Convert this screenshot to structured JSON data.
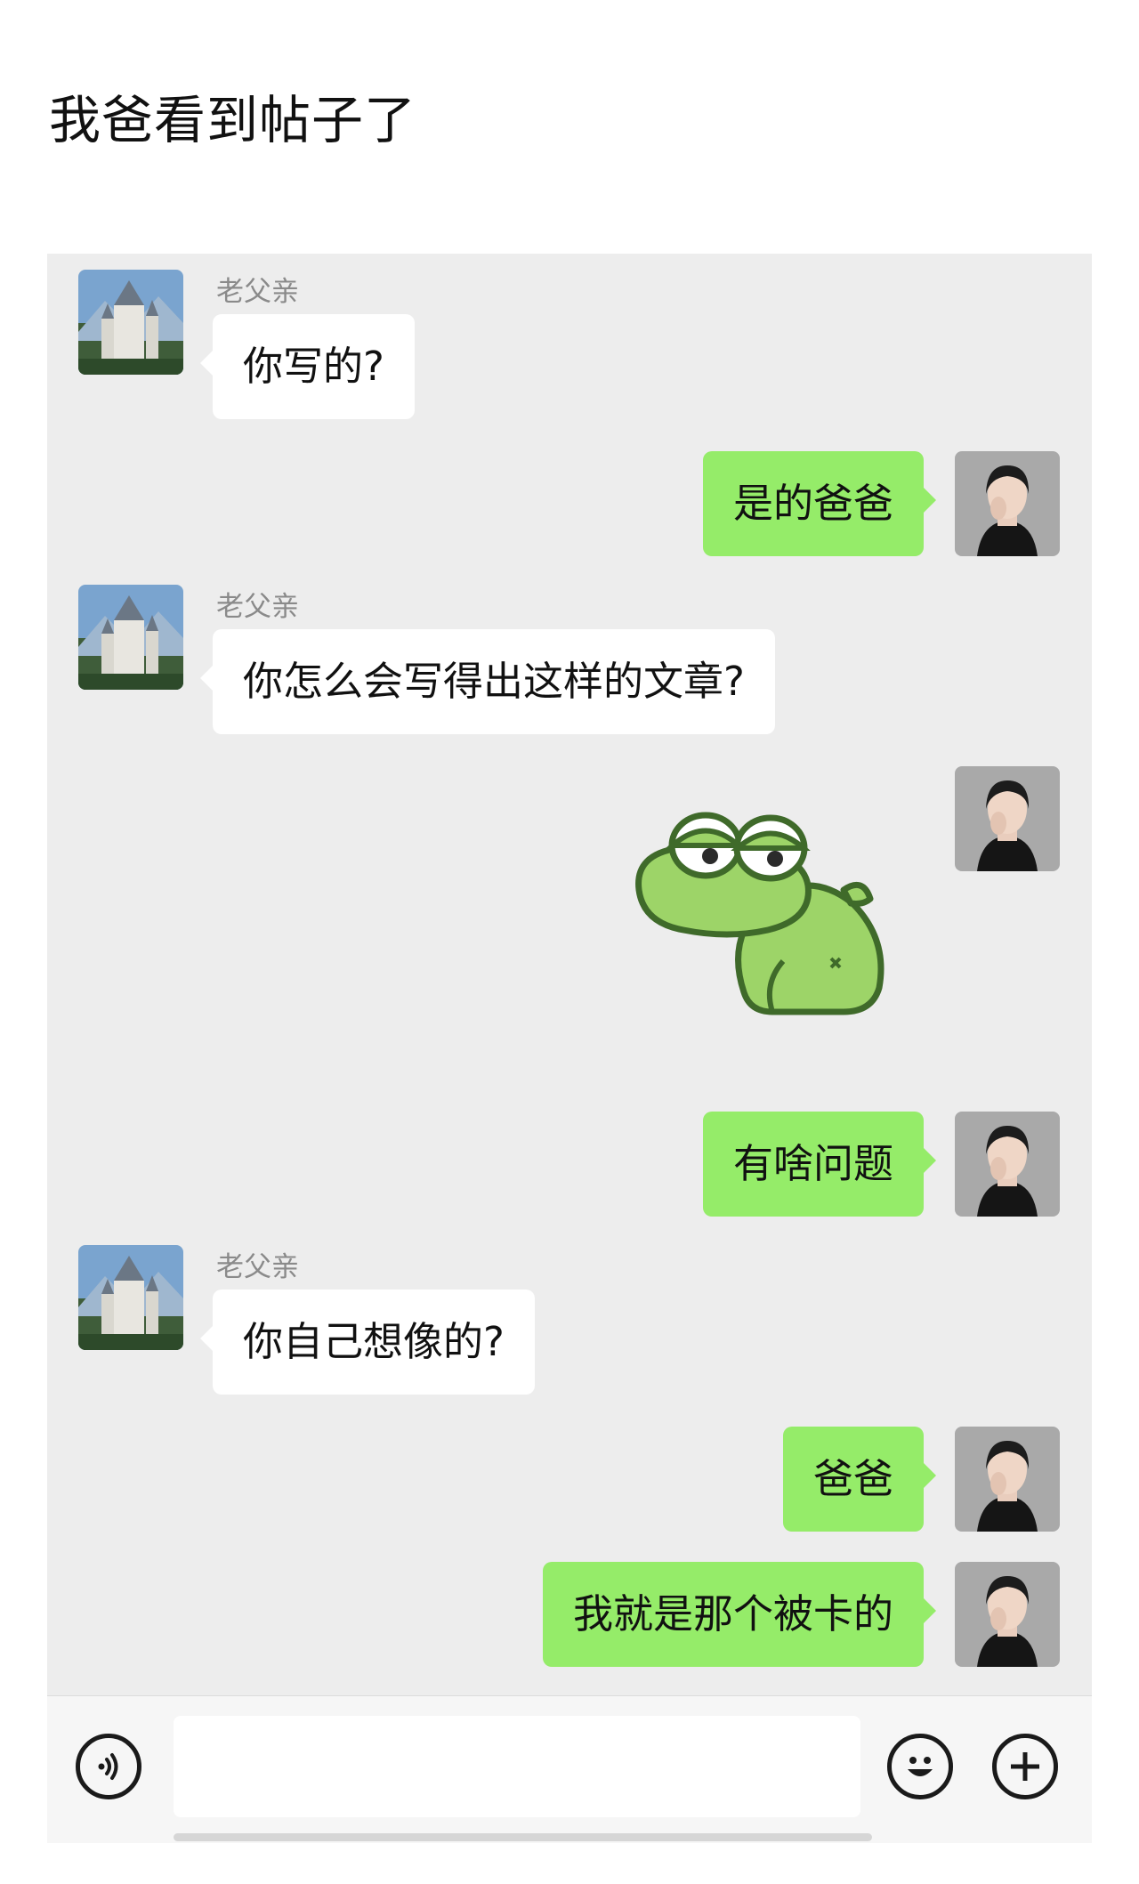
{
  "post": {
    "title": "我爸看到帖子了"
  },
  "chat": {
    "messages": [
      {
        "side": "in",
        "sender": "老父亲",
        "text": "你写的?"
      },
      {
        "side": "out",
        "text": "是的爸爸"
      },
      {
        "side": "in",
        "sender": "老父亲",
        "text": "你怎么会写得出这样的文章?"
      },
      {
        "side": "out",
        "type": "sticker",
        "sticker": "frog-turning-away"
      },
      {
        "side": "out",
        "text": "有啥问题"
      },
      {
        "side": "in",
        "sender": "老父亲",
        "text": "你自己想像的?"
      },
      {
        "side": "out",
        "text": "爸爸"
      },
      {
        "side": "out",
        "text": "我就是那个被卡的"
      }
    ]
  },
  "input_bar": {
    "voice_icon": "voice-icon",
    "emoji_icon": "emoji-icon",
    "add_icon": "plus-icon",
    "input_value": ""
  },
  "colors": {
    "chat_bg": "#ededed",
    "out_bubble": "#95ec69",
    "in_bubble": "#ffffff",
    "sender_name": "#8a8a8a"
  }
}
